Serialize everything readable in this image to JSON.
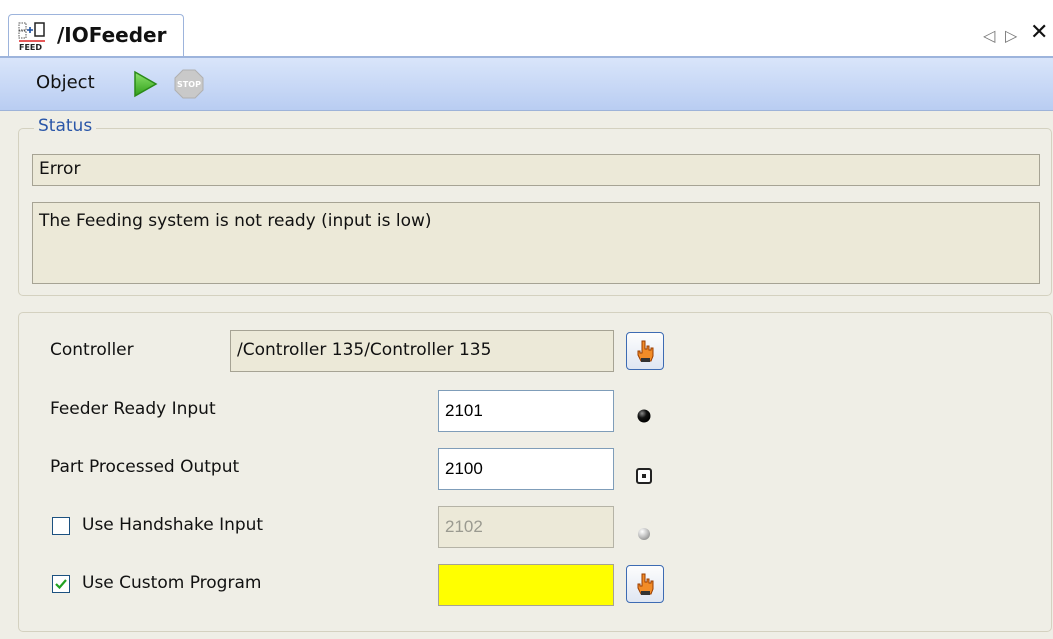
{
  "tab": {
    "title": "/IOFeeder",
    "icon": "feed-icon",
    "nav_prev": "◁",
    "nav_next": "▷",
    "close": "✕"
  },
  "toolbar": {
    "object_label": "Object",
    "play_icon": "play-icon",
    "stop_icon": "stop-icon",
    "stop_text": "STOP"
  },
  "status": {
    "legend": "Status",
    "state": "Error",
    "message": "The Feeding system is not ready (input is low)"
  },
  "settings": {
    "controller": {
      "label": "Controller",
      "value": "/Controller 135/Controller 135"
    },
    "feeder_ready": {
      "label": "Feeder Ready Input",
      "value": "2101",
      "led": "black"
    },
    "part_processed": {
      "label": "Part Processed Output",
      "value": "2100"
    },
    "handshake": {
      "label": "Use Handshake Input",
      "checked": false,
      "value": "2102",
      "led": "gray"
    },
    "custom_program": {
      "label": "Use Custom Program",
      "checked": true,
      "value": ""
    }
  },
  "colors": {
    "accent": "#2a56a8",
    "toolbar": "#c8d8f5",
    "custom_program_bg": "#ffff00"
  }
}
